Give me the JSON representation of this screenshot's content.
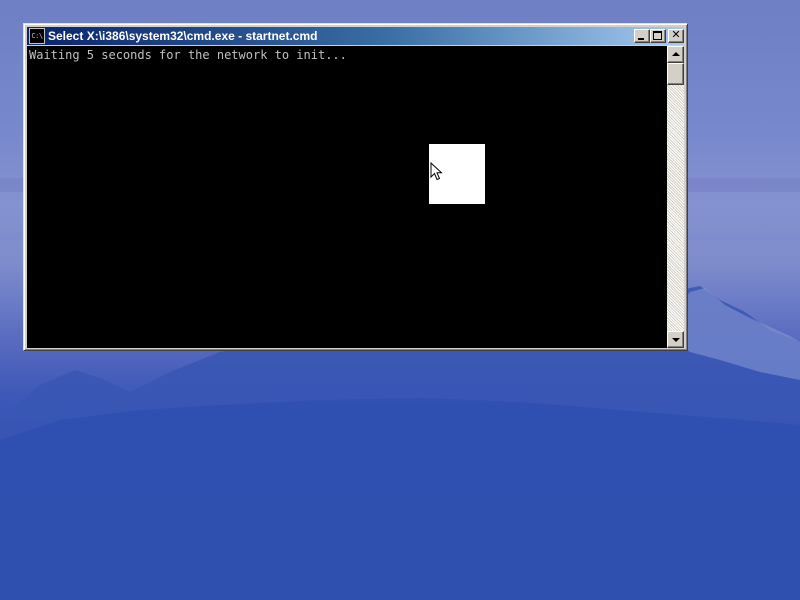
{
  "window": {
    "title": "Select X:\\i386\\system32\\cmd.exe - startnet.cmd",
    "icon": "cmd-icon",
    "icon_text": "C:\\"
  },
  "console": {
    "lines": [
      "Waiting 5 seconds for the network to init..."
    ],
    "background": "#000000",
    "foreground": "#c0c0c0"
  },
  "colors": {
    "titlebar_start": "#0a246a",
    "titlebar_end": "#a6caf0",
    "selection": "#ffffff"
  }
}
